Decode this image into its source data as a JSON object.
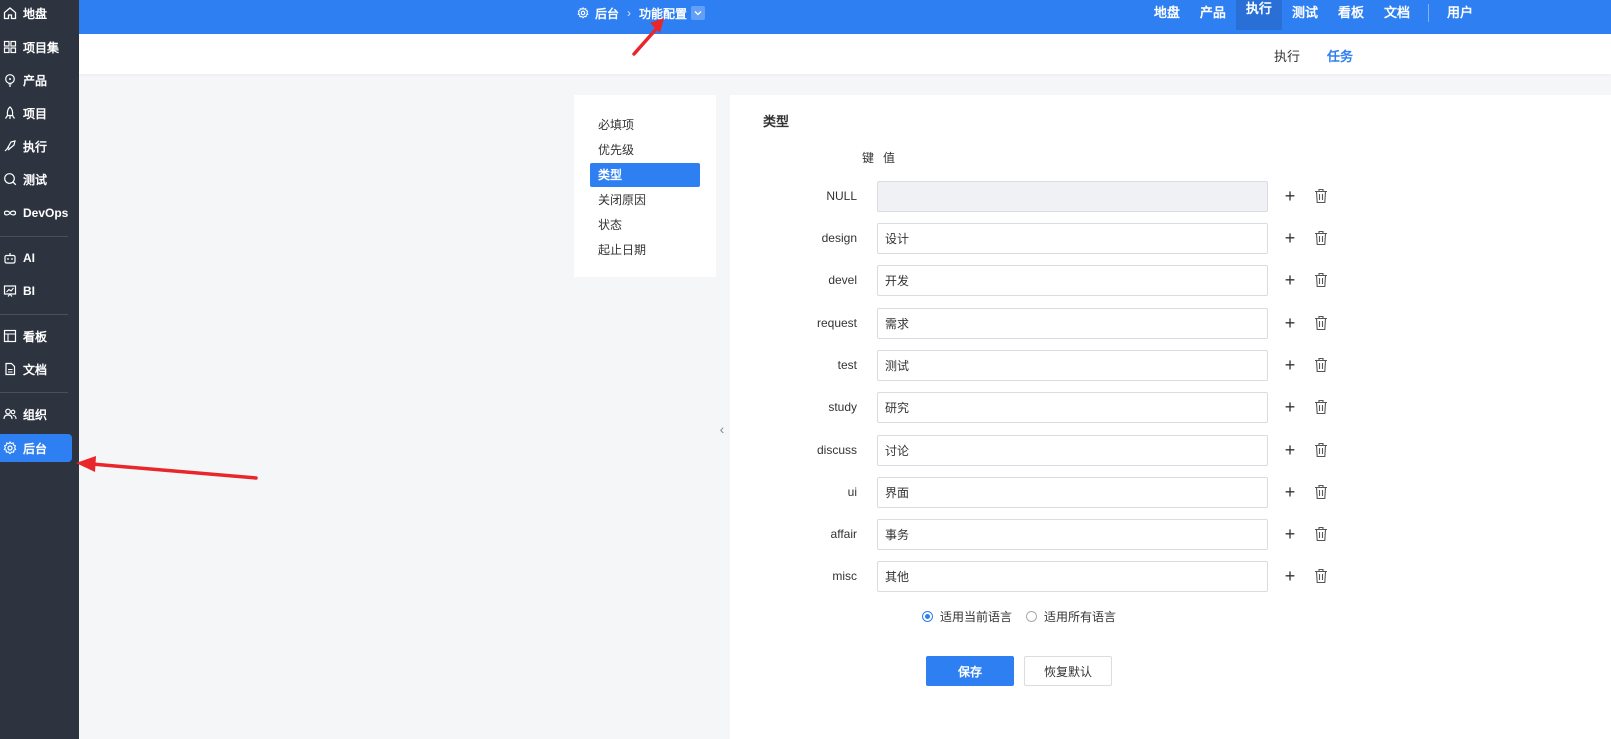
{
  "sidebar": {
    "items": [
      {
        "label": "地盘",
        "icon": "home-icon"
      },
      {
        "label": "项目集",
        "icon": "grid-icon"
      },
      {
        "label": "产品",
        "icon": "bulb-icon"
      },
      {
        "label": "项目",
        "icon": "rocket-icon"
      },
      {
        "label": "执行",
        "icon": "run-icon"
      },
      {
        "label": "测试",
        "icon": "search-icon"
      },
      {
        "label": "DevOps",
        "icon": "infinity-icon"
      },
      {
        "label": "AI",
        "icon": "robot-icon"
      },
      {
        "label": "BI",
        "icon": "chart-icon"
      },
      {
        "label": "看板",
        "icon": "board-icon"
      },
      {
        "label": "文档",
        "icon": "doc-icon"
      },
      {
        "label": "组织",
        "icon": "users-icon"
      },
      {
        "label": "后台",
        "icon": "gear-icon"
      }
    ],
    "active": "后台"
  },
  "header": {
    "breadcrumb": {
      "root": "后台",
      "current": "功能配置"
    },
    "nav": [
      "地盘",
      "产品",
      "执行",
      "测试",
      "看板",
      "文档",
      "用户"
    ],
    "active_nav": "执行"
  },
  "subheader": {
    "tabs": [
      "执行",
      "任务"
    ],
    "active_tab": "任务"
  },
  "settings_menu": {
    "items": [
      "必填项",
      "优先级",
      "类型",
      "关闭原因",
      "状态",
      "起止日期"
    ],
    "active": "类型"
  },
  "panel": {
    "title": "类型",
    "key_header": "键",
    "value_header": "值",
    "rows": [
      {
        "key": "NULL",
        "value": ""
      },
      {
        "key": "design",
        "value": "设计"
      },
      {
        "key": "devel",
        "value": "开发"
      },
      {
        "key": "request",
        "value": "需求"
      },
      {
        "key": "test",
        "value": "测试"
      },
      {
        "key": "study",
        "value": "研究"
      },
      {
        "key": "discuss",
        "value": "讨论"
      },
      {
        "key": "ui",
        "value": "界面"
      },
      {
        "key": "affair",
        "value": "事务"
      },
      {
        "key": "misc",
        "value": "其他"
      }
    ],
    "add_symbol": "+",
    "lang_options": [
      "适用当前语言",
      "适用所有语言"
    ],
    "lang_selected": "适用当前语言",
    "save_label": "保存",
    "reset_label": "恢复默认"
  },
  "colors": {
    "primary": "#2e7ff2",
    "sidebar_bg": "#2d3440",
    "annotation": "#e8262b"
  }
}
